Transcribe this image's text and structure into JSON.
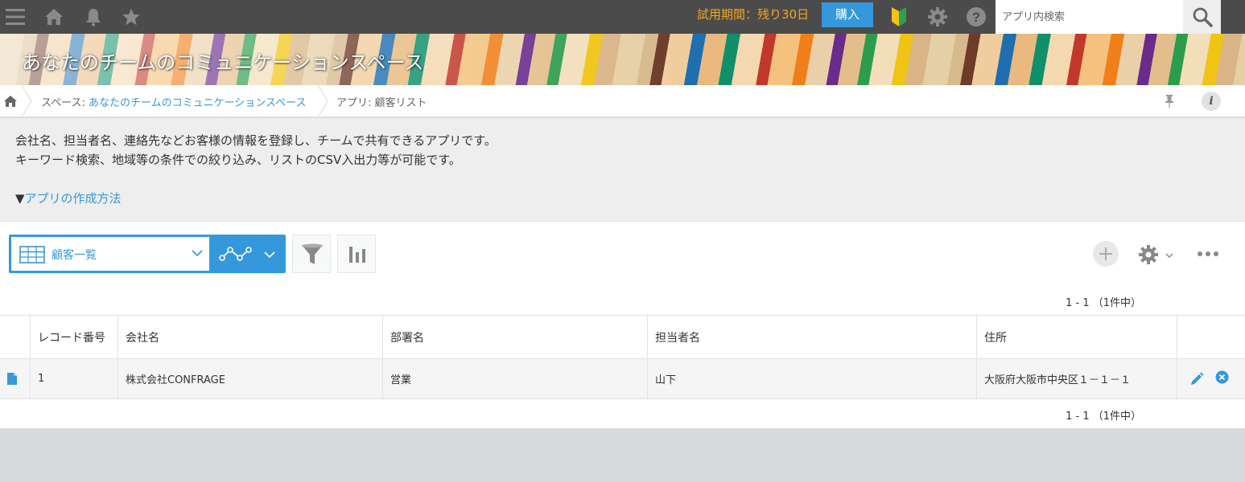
{
  "topbar": {
    "trial_text": "試用期間：残り30日",
    "buy_label": "購入",
    "search_placeholder": "アプリ内検索"
  },
  "banner": {
    "title": "あなたのチームのコミュニケーションスペース"
  },
  "breadcrumb": {
    "space_prefix": "スペース: ",
    "space_name": "あなたのチームのコミュニケーションスペース",
    "app_label": "アプリ: 顧客リスト"
  },
  "info_icon_label": "i",
  "description": {
    "line1": "会社名、担当者名、連絡先などお客様の情報を登録し、チームで共有できるアプリです。",
    "line2": "キーワード検索、地域等の条件での絞り込み、リストのCSV入出力等が可能です。",
    "link_arrow": "▼",
    "link_text": "アプリの作成方法"
  },
  "view": {
    "selected": "顧客一覧"
  },
  "pager": {
    "top": "1 - 1 （1件中）",
    "bottom": "1 - 1 （1件中）"
  },
  "table": {
    "columns": [
      "レコード番号",
      "会社名",
      "部署名",
      "担当者名",
      "住所"
    ],
    "rows": [
      [
        "1",
        "株式会社CONFRAGE",
        "営業",
        "山下",
        "大阪府大阪市中央区１－１－１"
      ]
    ]
  },
  "colors": {
    "accent": "#3498db",
    "topbar": "#4b4b4b",
    "trial": "#f5a623"
  }
}
